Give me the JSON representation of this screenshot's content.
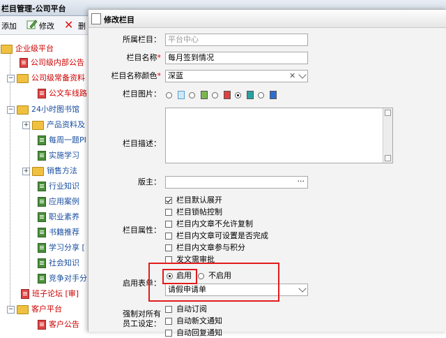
{
  "app": {
    "title": "栏目管理-公司平台"
  },
  "toolbar": {
    "add_label": "添加",
    "edit_label": "修改",
    "delete_label": "删"
  },
  "tree": {
    "items": [
      {
        "label": "企业级平台",
        "type": "folder",
        "color": "red"
      },
      {
        "label": "公司级内部公告",
        "type": "doc",
        "color": "red"
      },
      {
        "label": "公司级常备资料",
        "type": "folder",
        "color": "red"
      },
      {
        "label": "公文车线路",
        "type": "doc",
        "color": "red"
      },
      {
        "label": "24小时图书馆",
        "type": "folder",
        "color": "blue"
      },
      {
        "label": "产品资料及",
        "type": "folder",
        "color": "blue"
      },
      {
        "label": "每周一题PI",
        "type": "doc",
        "color": "blue"
      },
      {
        "label": "实施学习",
        "type": "doc",
        "color": "blue"
      },
      {
        "label": "销售方法",
        "type": "folder",
        "color": "blue"
      },
      {
        "label": "行业知识",
        "type": "doc",
        "color": "blue"
      },
      {
        "label": "应用案例",
        "type": "doc",
        "color": "blue"
      },
      {
        "label": "职业素养",
        "type": "doc",
        "color": "blue"
      },
      {
        "label": "书籍推荐",
        "type": "doc",
        "color": "blue"
      },
      {
        "label": "学习分享 [",
        "type": "doc",
        "color": "blue"
      },
      {
        "label": "社会知识",
        "type": "doc",
        "color": "blue"
      },
      {
        "label": "竞争对手分",
        "type": "doc",
        "color": "blue"
      },
      {
        "label": "班子论坛 [审]",
        "type": "doc",
        "color": "red"
      },
      {
        "label": "客户平台",
        "type": "folder",
        "color": "red"
      },
      {
        "label": "客户公告",
        "type": "doc",
        "color": "red"
      }
    ]
  },
  "dialog": {
    "title": "修改栏目",
    "parent_label": "所属栏目：",
    "parent_placeholder": "平台中心",
    "name_label": "栏目名称",
    "name_value": "每月签到情况",
    "color_label": "栏目名称颜色",
    "color_value": "深蓝",
    "clear_symbol": "✕",
    "image_label": "栏目图片：",
    "desc_label": "栏目描述：",
    "moderator_label": "版主：",
    "moderator_button": "···",
    "attr_label": "栏目属性：",
    "attrs": [
      {
        "label": "栏目默认展开",
        "checked": true
      },
      {
        "label": "栏目锁帖控制",
        "checked": false
      },
      {
        "label": "栏目内文章不允许复制",
        "checked": false
      },
      {
        "label": "栏目内文章可设置是否完成",
        "checked": false
      },
      {
        "label": "栏目内文章参与积分",
        "checked": false
      },
      {
        "label": "发文需审批",
        "checked": false
      }
    ],
    "form_label": "启用表单：",
    "form_enable": "启用",
    "form_disable": "不启用",
    "form_value": "请假申请单",
    "force_label_1": "强制对所有",
    "force_label_2": "员工设定：",
    "force_items": [
      {
        "label": "自动订阅",
        "checked": false
      },
      {
        "label": "自动新文通知",
        "checked": false
      },
      {
        "label": "自动回复通知",
        "checked": false
      }
    ]
  },
  "colors": {
    "highlight": "#e21b1b",
    "tree_red": "#cc0000",
    "tree_blue": "#1a4fa0"
  }
}
